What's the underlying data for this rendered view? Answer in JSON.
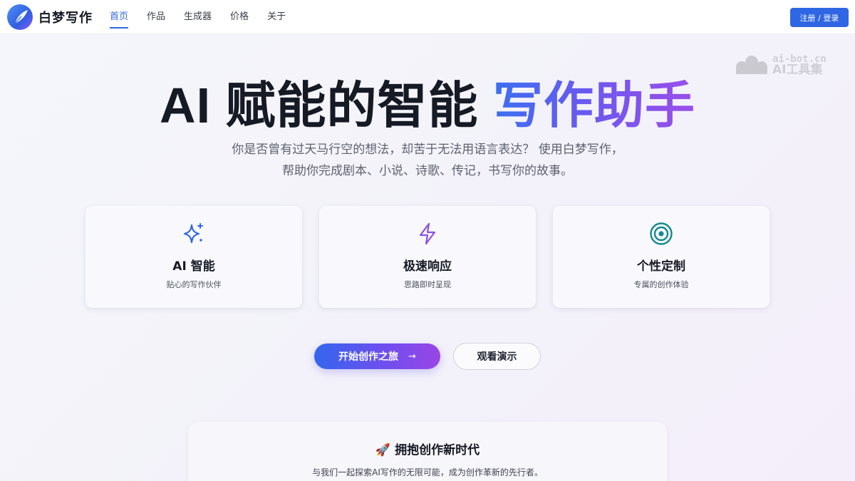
{
  "header": {
    "brand": "白梦写作",
    "nav": [
      "首页",
      "作品",
      "生成器",
      "价格",
      "关于"
    ],
    "active_nav": "首页",
    "login_label": "注册 / 登录"
  },
  "watermark": {
    "line1": "ai-bot.cn",
    "line2": "AI工具集"
  },
  "hero": {
    "title_plain": "AI 赋能的智能 ",
    "title_highlight": "写作助手",
    "subtitle": "你是否曾有过天马行空的想法，却苦于无法用语言表达？ 使用白梦写作，帮助你完成剧本、小说、诗歌、传记，书写你的故事。"
  },
  "features": [
    {
      "icon": "sparkles-icon",
      "title": "AI 智能",
      "desc": "贴心的写作伙伴",
      "color": "#2f66e3"
    },
    {
      "icon": "lightning-icon",
      "title": "极速响应",
      "desc": "思路即时呈现",
      "color": "#8b4fe8"
    },
    {
      "icon": "target-icon",
      "title": "个性定制",
      "desc": "专属的创作体验",
      "color": "#138a8e"
    }
  ],
  "cta": {
    "start_label": "开始创作之旅",
    "start_arrow": "→",
    "demo_label": "观看演示"
  },
  "panel": {
    "emoji": "🚀",
    "title": "拥抱创作新时代",
    "desc": "与我们一起探索AI写作的无限可能，成为创作革新的先行者。"
  }
}
